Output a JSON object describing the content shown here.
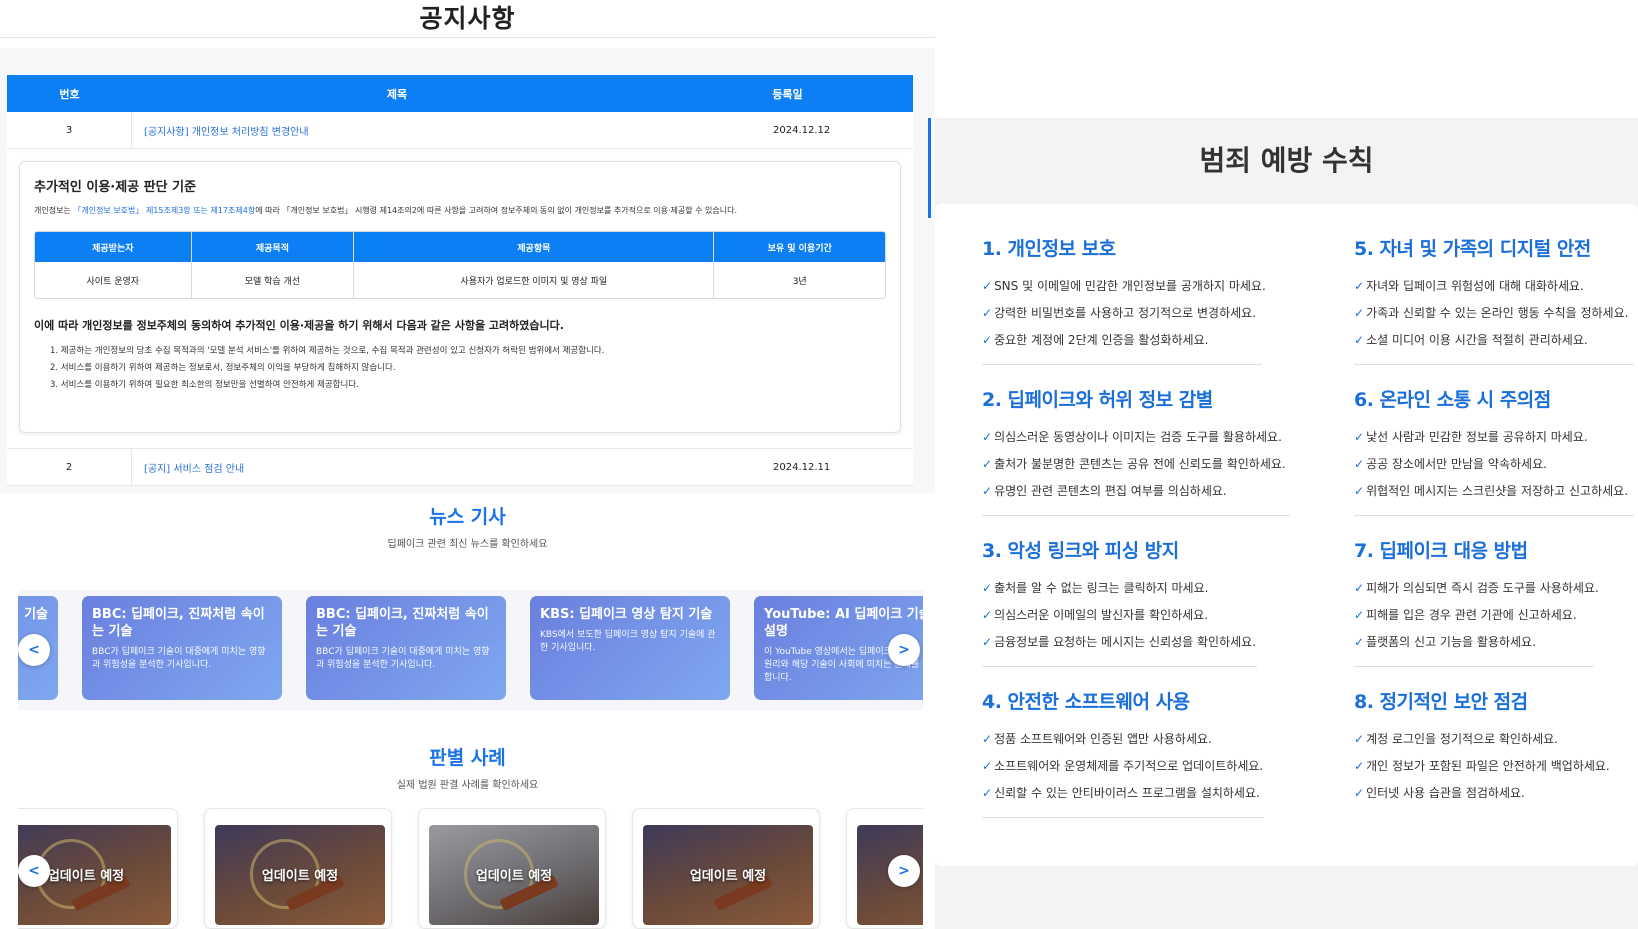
{
  "notice": {
    "title": "공지사항",
    "headers": {
      "num": "번호",
      "title": "제목",
      "date": "등록일"
    },
    "rows": [
      {
        "num": "3",
        "title": "[공지사항] 개인정보 처리방침 변경안내",
        "date": "2024.12.12"
      },
      {
        "num": "2",
        "title": "[공지] 서비스 점검 안내",
        "date": "2024.12.11"
      }
    ],
    "detail": {
      "heading": "추가적인 이용·제공 판단 기준",
      "intro_prefix": "개인정보는 ",
      "intro_highlight": "「개인정보 보호법」 제15조제3항 또는 제17조제4항",
      "intro_suffix": "에 따라 「개인정보 보호법」 시행령 제14조의2에 따른 사항을 고려하여 정보주체의 동의 없이 개인정보를 추가적으로 이용·제공할 수 있습니다.",
      "table_headers": [
        "제공받는자",
        "제공목적",
        "제공항목",
        "보유 및 이용기간"
      ],
      "table_row": [
        "사이트 운영자",
        "모델 학습 개선",
        "사용자가 업로드한 이미지 및 영상 파일",
        "3년"
      ],
      "bold_line": "이에 따라 개인정보를 정보주체의 동의하여 추가적인 이용·제공을 하기 위해서 다음과 같은 사항을 고려하였습니다.",
      "items": [
        "1. 제공하는 개인정보의 당초 수집 목적과의 '모델 분석 서비스'를 위하여 제공하는 것으로, 수집 목적과 관련성이 있고 신청자가 허락된 범위에서 제공합니다.",
        "2. 서비스를 이용하기 위하여 제공하는 정보로서, 정보주체의 이익을 부당하게 침해하지 않습니다.",
        "3. 서비스를 이용하기 위하여 필요한 최소한의 정보만을 선별하여 안전하게 제공합니다."
      ]
    }
  },
  "news": {
    "title": "뉴스 기사",
    "subtitle": "딥페이크 관련 최신 뉴스를 확인하세요",
    "prev_label": "<",
    "next_label": ">",
    "cards": [
      {
        "title": "기술",
        "desc": ""
      },
      {
        "title": "BBC: 딥페이크, 진짜처럼 속이는 기술",
        "desc": "BBC가 딥페이크 기술이 대중에게 미치는 영향과 위험성을 분석한 기사입니다."
      },
      {
        "title": "BBC: 딥페이크, 진짜처럼 속이는 기술",
        "desc": "BBC가 딥페이크 기술이 대중에게 미치는 영향과 위험성을 분석한 기사입니다."
      },
      {
        "title": "KBS: 딥페이크 영상 탐지 기술",
        "desc": "KBS에서 보도한 딥페이크 영상 탐지 기술에 관한 기사입니다."
      },
      {
        "title": "YouTube: AI 딥페이크 기술 설명",
        "desc": "이 YouTube 영상에서는 딥페이크 기술의 작동 원리와 해당 기술이 사회에 미치는 문제를 설명합니다."
      }
    ]
  },
  "cases": {
    "title": "판별 사례",
    "subtitle": "실제 법원 판결 사례를 확인하세요",
    "prev_label": "<",
    "next_label": ">",
    "cards": [
      {
        "label": "업데이트 예정"
      },
      {
        "label": "업데이트 예정"
      },
      {
        "label": "업데이트 예정"
      },
      {
        "label": "업데이트 예정"
      },
      {
        "label": ""
      }
    ]
  },
  "prevention": {
    "title": "범죄 예방 수칙",
    "check_mark": "✓",
    "rules": [
      {
        "heading": "1. 개인정보 보호",
        "items": [
          "SNS 및 이메일에 민감한 개인정보를 공개하지 마세요.",
          "강력한 비밀번호를 사용하고 정기적으로 변경하세요.",
          "중요한 계정에 2단계 인증을 활성화하세요."
        ]
      },
      {
        "heading": "2. 딥페이크와 허위 정보 감별",
        "items": [
          "의심스러운 동영상이나 이미지는 검증 도구를 활용하세요.",
          "출처가 불분명한 콘텐츠는 공유 전에 신뢰도를 확인하세요.",
          "유명인 관련 콘텐츠의 편집 여부를 의심하세요."
        ]
      },
      {
        "heading": "3. 악성 링크와 피싱 방지",
        "items": [
          "출처를 알 수 없는 링크는 클릭하지 마세요.",
          "의심스러운 이메일의 발신자를 확인하세요.",
          "금융정보를 요청하는 메시지는 신뢰성을 확인하세요."
        ]
      },
      {
        "heading": "4. 안전한 소프트웨어 사용",
        "items": [
          "정품 소프트웨어와 인증된 앱만 사용하세요.",
          "소프트웨어와 운영체제를 주기적으로 업데이트하세요.",
          "신뢰할 수 있는 안티바이러스 프로그램을 설치하세요."
        ]
      },
      {
        "heading": "5. 자녀 및 가족의 디지털 안전",
        "items": [
          "자녀와 딥페이크 위험성에 대해 대화하세요.",
          "가족과 신뢰할 수 있는 온라인 행동 수칙을 정하세요.",
          "소셜 미디어 이용 시간을 적절히 관리하세요."
        ]
      },
      {
        "heading": "6. 온라인 소통 시 주의점",
        "items": [
          "낯선 사람과 민감한 정보를 공유하지 마세요.",
          "공공 장소에서만 만남을 약속하세요.",
          "위협적인 메시지는 스크린샷을 저장하고 신고하세요."
        ]
      },
      {
        "heading": "7. 딥페이크 대응 방법",
        "items": [
          "피해가 의심되면 즉시 검증 도구를 사용하세요.",
          "피해를 입은 경우 관련 기관에 신고하세요.",
          "플랫폼의 신고 기능을 활용하세요."
        ]
      },
      {
        "heading": "8. 정기적인 보안 점검",
        "items": [
          "계정 로그인을 정기적으로 확인하세요.",
          "개인 정보가 포함된 파일은 안전하게 백업하세요.",
          "인터넷 사용 습관을 점검하세요."
        ]
      }
    ]
  }
}
